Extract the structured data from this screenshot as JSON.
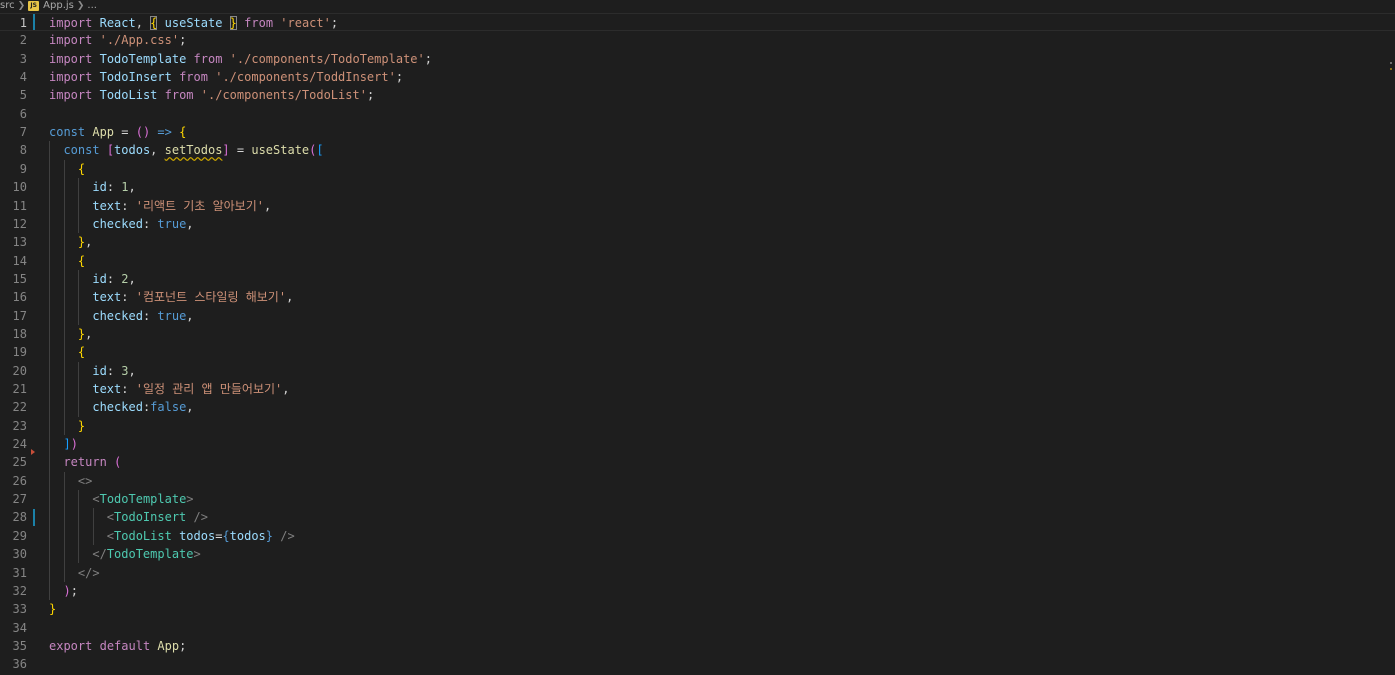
{
  "breadcrumb": {
    "folder": "src",
    "file_badge": "JS",
    "file": "App.js",
    "more": "..."
  },
  "editor": {
    "current_line": 1,
    "lines": [
      {
        "n": "1",
        "t": [
          [
            "import",
            "kw"
          ],
          [
            " ",
            "pl"
          ],
          [
            "React",
            "var"
          ],
          [
            ", ",
            "pl"
          ],
          [
            "{",
            "p1",
            "box"
          ],
          [
            " ",
            "pl"
          ],
          [
            "useState",
            "var"
          ],
          [
            " ",
            "pl"
          ],
          [
            "}",
            "p1",
            "box"
          ],
          [
            " ",
            "pl"
          ],
          [
            "from",
            "kw"
          ],
          [
            " ",
            "pl"
          ],
          [
            "'react'",
            "str"
          ],
          [
            ";",
            "pl"
          ]
        ]
      },
      {
        "n": "2",
        "t": [
          [
            "import",
            "kw"
          ],
          [
            " ",
            "pl"
          ],
          [
            "'./App.css'",
            "str"
          ],
          [
            ";",
            "pl"
          ]
        ]
      },
      {
        "n": "3",
        "t": [
          [
            "import",
            "kw"
          ],
          [
            " ",
            "pl"
          ],
          [
            "TodoTemplate",
            "var"
          ],
          [
            " ",
            "pl"
          ],
          [
            "from",
            "kw"
          ],
          [
            " ",
            "pl"
          ],
          [
            "'./components/TodoTemplate'",
            "str"
          ],
          [
            ";",
            "pl"
          ]
        ]
      },
      {
        "n": "4",
        "t": [
          [
            "import",
            "kw"
          ],
          [
            " ",
            "pl"
          ],
          [
            "TodoInsert",
            "var"
          ],
          [
            " ",
            "pl"
          ],
          [
            "from",
            "kw"
          ],
          [
            " ",
            "pl"
          ],
          [
            "'./components/ToddInsert'",
            "str"
          ],
          [
            ";",
            "pl"
          ]
        ]
      },
      {
        "n": "5",
        "t": [
          [
            "import",
            "kw"
          ],
          [
            " ",
            "pl"
          ],
          [
            "TodoList",
            "var"
          ],
          [
            " ",
            "pl"
          ],
          [
            "from",
            "kw"
          ],
          [
            " ",
            "pl"
          ],
          [
            "'./components/TodoList'",
            "str"
          ],
          [
            ";",
            "pl"
          ]
        ]
      },
      {
        "n": "6",
        "t": []
      },
      {
        "n": "7",
        "t": [
          [
            "const",
            "st"
          ],
          [
            " ",
            "pl"
          ],
          [
            "App",
            "fn"
          ],
          [
            " = ",
            "pl"
          ],
          [
            "()",
            "p2"
          ],
          [
            " ",
            "pl"
          ],
          [
            "=>",
            "st"
          ],
          [
            " ",
            "pl"
          ],
          [
            "{",
            "p1"
          ]
        ]
      },
      {
        "n": "8",
        "t": [
          [
            "  ",
            "pl"
          ],
          [
            "const",
            "st"
          ],
          [
            " ",
            "pl"
          ],
          [
            "[",
            "p2"
          ],
          [
            "todos",
            "var"
          ],
          [
            ", ",
            "pl"
          ],
          [
            "setTodos",
            "fn",
            "squig"
          ],
          [
            "]",
            "p2"
          ],
          [
            " = ",
            "pl"
          ],
          [
            "useState",
            "fn"
          ],
          [
            "(",
            "p2"
          ],
          [
            "[",
            "p3"
          ]
        ]
      },
      {
        "n": "9",
        "t": [
          [
            "    ",
            "pl"
          ],
          [
            "{",
            "p1"
          ]
        ]
      },
      {
        "n": "10",
        "t": [
          [
            "      ",
            "pl"
          ],
          [
            "id",
            "var"
          ],
          [
            ": ",
            "pl"
          ],
          [
            "1",
            "num"
          ],
          [
            ",",
            "pl"
          ]
        ]
      },
      {
        "n": "11",
        "t": [
          [
            "      ",
            "pl"
          ],
          [
            "text",
            "var"
          ],
          [
            ": ",
            "pl"
          ],
          [
            "'리액트 기초 알아보기'",
            "str"
          ],
          [
            ",",
            "pl"
          ]
        ]
      },
      {
        "n": "12",
        "t": [
          [
            "      ",
            "pl"
          ],
          [
            "checked",
            "var"
          ],
          [
            ": ",
            "pl"
          ],
          [
            "true",
            "st"
          ],
          [
            ",",
            "pl"
          ]
        ]
      },
      {
        "n": "13",
        "t": [
          [
            "    ",
            "pl"
          ],
          [
            "}",
            "p1"
          ],
          [
            ",",
            "pl"
          ]
        ]
      },
      {
        "n": "14",
        "t": [
          [
            "    ",
            "pl"
          ],
          [
            "{",
            "p1"
          ]
        ]
      },
      {
        "n": "15",
        "t": [
          [
            "      ",
            "pl"
          ],
          [
            "id",
            "var"
          ],
          [
            ": ",
            "pl"
          ],
          [
            "2",
            "num"
          ],
          [
            ",",
            "pl"
          ]
        ]
      },
      {
        "n": "16",
        "t": [
          [
            "      ",
            "pl"
          ],
          [
            "text",
            "var"
          ],
          [
            ": ",
            "pl"
          ],
          [
            "'컴포넌트 스타일링 해보기'",
            "str"
          ],
          [
            ",",
            "pl"
          ]
        ]
      },
      {
        "n": "17",
        "t": [
          [
            "      ",
            "pl"
          ],
          [
            "checked",
            "var"
          ],
          [
            ": ",
            "pl"
          ],
          [
            "true",
            "st"
          ],
          [
            ",",
            "pl"
          ]
        ]
      },
      {
        "n": "18",
        "t": [
          [
            "    ",
            "pl"
          ],
          [
            "}",
            "p1"
          ],
          [
            ",",
            "pl"
          ]
        ]
      },
      {
        "n": "19",
        "t": [
          [
            "    ",
            "pl"
          ],
          [
            "{",
            "p1"
          ]
        ]
      },
      {
        "n": "20",
        "t": [
          [
            "      ",
            "pl"
          ],
          [
            "id",
            "var"
          ],
          [
            ": ",
            "pl"
          ],
          [
            "3",
            "num"
          ],
          [
            ",",
            "pl"
          ]
        ]
      },
      {
        "n": "21",
        "t": [
          [
            "      ",
            "pl"
          ],
          [
            "text",
            "var"
          ],
          [
            ": ",
            "pl"
          ],
          [
            "'일정 관리 앱 만들어보기'",
            "str"
          ],
          [
            ",",
            "pl"
          ]
        ]
      },
      {
        "n": "22",
        "t": [
          [
            "      ",
            "pl"
          ],
          [
            "checked",
            "var"
          ],
          [
            ":",
            "pl"
          ],
          [
            "false",
            "st"
          ],
          [
            ",",
            "pl"
          ]
        ]
      },
      {
        "n": "23",
        "t": [
          [
            "    ",
            "pl"
          ],
          [
            "}",
            "p1"
          ]
        ]
      },
      {
        "n": "24",
        "t": [
          [
            "  ",
            "pl"
          ],
          [
            "]",
            "p3"
          ],
          [
            ")",
            "p2"
          ]
        ]
      },
      {
        "n": "25",
        "t": [
          [
            "  ",
            "pl"
          ],
          [
            "return",
            "kw"
          ],
          [
            " ",
            "pl"
          ],
          [
            "(",
            "p2"
          ]
        ]
      },
      {
        "n": "26",
        "t": [
          [
            "    ",
            "pl"
          ],
          [
            "<>",
            "ang"
          ]
        ]
      },
      {
        "n": "27",
        "t": [
          [
            "      ",
            "pl"
          ],
          [
            "<",
            "ang"
          ],
          [
            "TodoTemplate",
            "tag"
          ],
          [
            ">",
            "ang"
          ]
        ]
      },
      {
        "n": "28",
        "t": [
          [
            "        ",
            "pl"
          ],
          [
            "<",
            "ang"
          ],
          [
            "TodoInsert",
            "tag"
          ],
          [
            " ",
            "pl"
          ],
          [
            "/>",
            "ang"
          ]
        ]
      },
      {
        "n": "29",
        "t": [
          [
            "        ",
            "pl"
          ],
          [
            "<",
            "ang"
          ],
          [
            "TodoList",
            "tag"
          ],
          [
            " ",
            "pl"
          ],
          [
            "todos",
            "var"
          ],
          [
            "=",
            "pl"
          ],
          [
            "{",
            "st"
          ],
          [
            "todos",
            "var"
          ],
          [
            "}",
            "st"
          ],
          [
            " ",
            "pl"
          ],
          [
            "/>",
            "ang"
          ]
        ]
      },
      {
        "n": "30",
        "t": [
          [
            "      ",
            "pl"
          ],
          [
            "</",
            "ang"
          ],
          [
            "TodoTemplate",
            "tag"
          ],
          [
            ">",
            "ang"
          ]
        ]
      },
      {
        "n": "31",
        "t": [
          [
            "    ",
            "pl"
          ],
          [
            "</>",
            "ang"
          ]
        ]
      },
      {
        "n": "32",
        "t": [
          [
            "  ",
            "pl"
          ],
          [
            ")",
            "p2"
          ],
          [
            ";",
            "pl"
          ]
        ]
      },
      {
        "n": "33",
        "t": [
          [
            "}",
            "p1"
          ]
        ]
      },
      {
        "n": "34",
        "t": []
      },
      {
        "n": "35",
        "t": [
          [
            "export",
            "kw"
          ],
          [
            " ",
            "pl"
          ],
          [
            "default",
            "kw"
          ],
          [
            " ",
            "pl"
          ],
          [
            "App",
            "fn"
          ],
          [
            ";",
            "pl"
          ]
        ]
      },
      {
        "n": "36",
        "t": []
      }
    ]
  }
}
